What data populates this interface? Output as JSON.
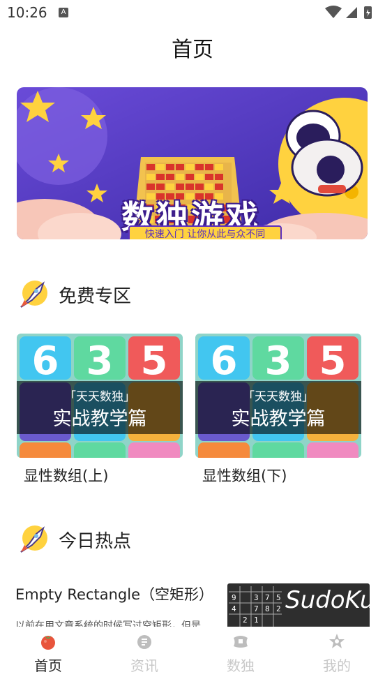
{
  "status_bar": {
    "time": "10:26",
    "notification_glyph": "A"
  },
  "header": {
    "title": "首页"
  },
  "banner": {
    "title": "数独游戏",
    "subtitle": "快速入门 让你从此与众不同"
  },
  "free_section": {
    "title": "免费专区",
    "cards": [
      {
        "thumb_subtitle": "「天天数独」",
        "thumb_title": "实战教学篇",
        "caption": "显性数组(上)"
      },
      {
        "thumb_subtitle": "「天天数独」",
        "thumb_title": "实战教学篇",
        "caption": "显性数组(下)"
      }
    ]
  },
  "hot_section": {
    "title": "今日热点",
    "article": {
      "title": "Empty Rectangle（空矩形）",
      "snippet": "以前在用文章系统的时候写过空矩形，但是",
      "thumb_text": "SudoKu"
    }
  },
  "tabbar": {
    "tabs": [
      {
        "label": "首页",
        "icon": "tomato-icon",
        "active": true
      },
      {
        "label": "资讯",
        "icon": "news-icon",
        "active": false
      },
      {
        "label": "数独",
        "icon": "sudoku-icon",
        "active": false
      },
      {
        "label": "我的",
        "icon": "profile-icon",
        "active": false
      }
    ]
  },
  "colors": {
    "accent": "#e8553c",
    "inactive": "#c8c8c8",
    "banner_bg": "#5a3ed1"
  }
}
